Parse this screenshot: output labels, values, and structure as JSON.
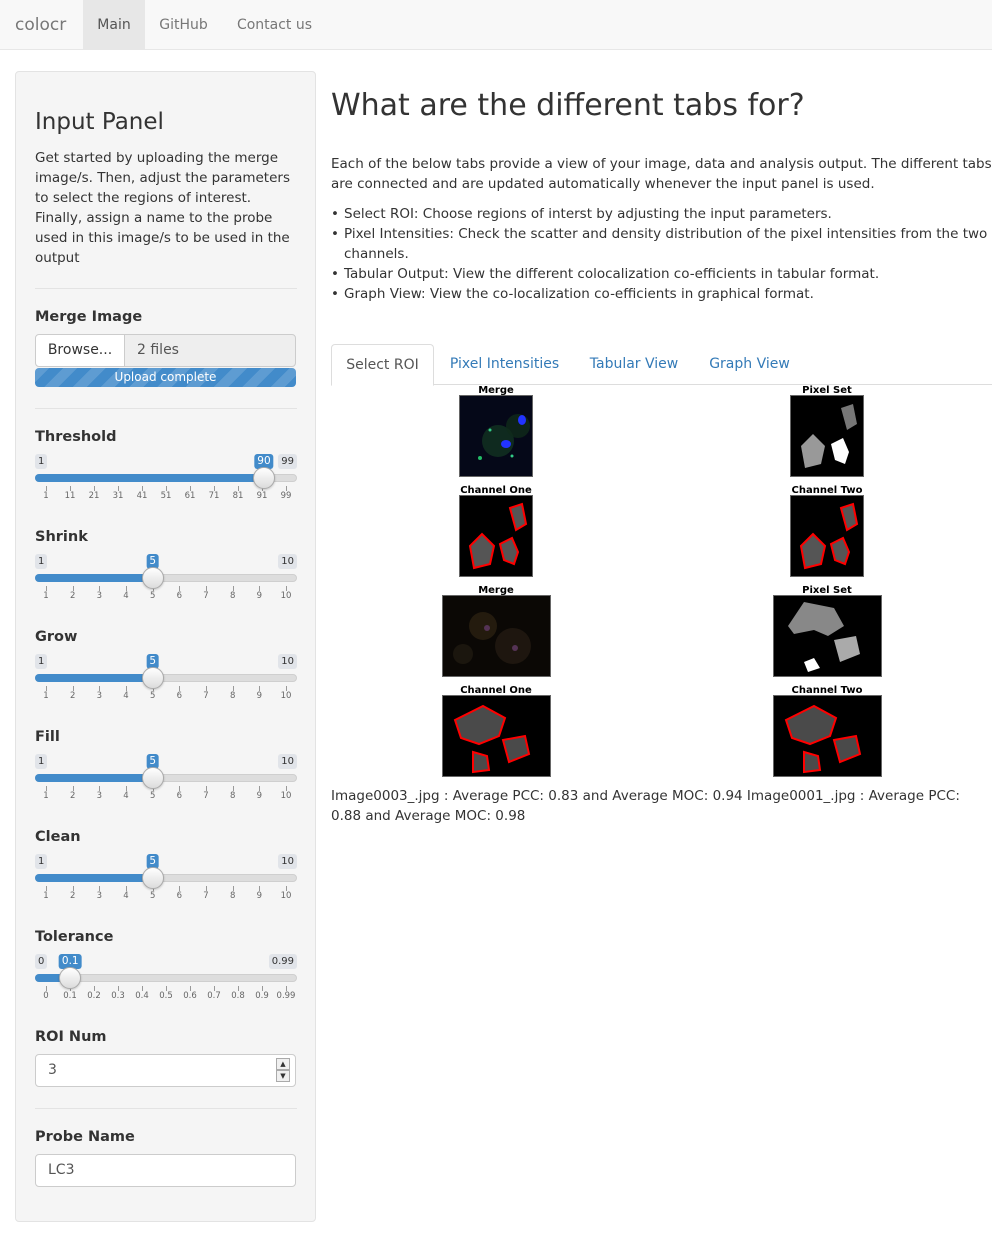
{
  "navbar": {
    "brand": "colocr",
    "items": [
      {
        "label": "Main",
        "active": true
      },
      {
        "label": "GitHub",
        "active": false
      },
      {
        "label": "Contact us",
        "active": false
      }
    ]
  },
  "sidebar": {
    "title": "Input Panel",
    "description": "Get started by uploading the merge image/s. Then, adjust the parameters to select the regions of interest. Finally, assign a name to the probe used in this image/s to be used in the output",
    "merge_image": {
      "label": "Merge Image",
      "browse_label": "Browse...",
      "file_text": "2 files",
      "progress_text": "Upload complete",
      "progress_value": 100
    },
    "sliders": [
      {
        "label": "Threshold",
        "min": "1",
        "max": "99",
        "value": "90",
        "ticks": [
          "1",
          "11",
          "21",
          "31",
          "41",
          "51",
          "61",
          "71",
          "81",
          "91",
          "99"
        ]
      },
      {
        "label": "Shrink",
        "min": "1",
        "max": "10",
        "value": "5",
        "ticks": [
          "1",
          "2",
          "3",
          "4",
          "5",
          "6",
          "7",
          "8",
          "9",
          "10"
        ]
      },
      {
        "label": "Grow",
        "min": "1",
        "max": "10",
        "value": "5",
        "ticks": [
          "1",
          "2",
          "3",
          "4",
          "5",
          "6",
          "7",
          "8",
          "9",
          "10"
        ]
      },
      {
        "label": "Fill",
        "min": "1",
        "max": "10",
        "value": "5",
        "ticks": [
          "1",
          "2",
          "3",
          "4",
          "5",
          "6",
          "7",
          "8",
          "9",
          "10"
        ]
      },
      {
        "label": "Clean",
        "min": "1",
        "max": "10",
        "value": "5",
        "ticks": [
          "1",
          "2",
          "3",
          "4",
          "5",
          "6",
          "7",
          "8",
          "9",
          "10"
        ]
      },
      {
        "label": "Tolerance",
        "min": "0",
        "max": "0.99",
        "value": "0.1",
        "ticks": [
          "0",
          "0.1",
          "0.2",
          "0.3",
          "0.4",
          "0.5",
          "0.6",
          "0.7",
          "0.8",
          "0.9",
          "0.99"
        ]
      }
    ],
    "roi_num": {
      "label": "ROI Num",
      "value": "3"
    },
    "probe_name": {
      "label": "Probe Name",
      "value": "LC3"
    }
  },
  "main": {
    "title": "What are the different tabs for?",
    "intro": "Each of the below tabs provide a view of your image, data and analysis output. The different tabs are connected and are updated automatically whenever the input panel is used.",
    "bullets": [
      "Select ROI: Choose regions of interst by adjusting the input parameters.",
      "Pixel Intensities: Check the scatter and density distribution of the pixel intensities from the two channels.",
      "Tabular Output: View the different colocalization co-efficients in tabular format.",
      "Graph View: View the co-localization co-efficients in graphical format."
    ],
    "tabs": [
      {
        "label": "Select ROI",
        "active": true
      },
      {
        "label": "Pixel Intensities",
        "active": false
      },
      {
        "label": "Tabular View",
        "active": false
      },
      {
        "label": "Graph View",
        "active": false
      }
    ],
    "figures": [
      {
        "caption": "Merge"
      },
      {
        "caption": "Pixel Set"
      },
      {
        "caption": "Channel One"
      },
      {
        "caption": "Channel Two"
      },
      {
        "caption": "Merge"
      },
      {
        "caption": "Pixel Set"
      },
      {
        "caption": "Channel One"
      },
      {
        "caption": "Channel Two"
      }
    ],
    "result_text": "Image0003_.jpg : Average PCC: 0.83 and Average MOC: 0.94 Image0001_.jpg : Average PCC: 0.88 and Average MOC: 0.98"
  },
  "colors": {
    "accent": "#428bca",
    "link": "#337ab7",
    "roi_outline": "#ff0000"
  }
}
